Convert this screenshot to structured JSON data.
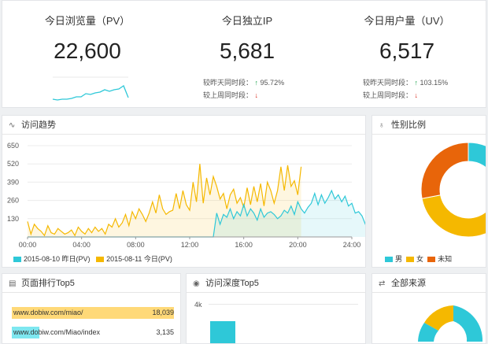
{
  "stats": [
    {
      "label": "今日浏览量（PV）",
      "value": "22,600"
    },
    {
      "label": "今日独立IP",
      "value": "5,681",
      "compare_day_label": "较昨天同时段：",
      "compare_day_value": "95.72%",
      "compare_week_label": "较上周同时段："
    },
    {
      "label": "今日用户量（UV）",
      "value": "6,517",
      "compare_day_label": "较昨天同时段：",
      "compare_day_value": "103.15%",
      "compare_week_label": "较上周同时段："
    }
  ],
  "trend": {
    "title": "访问趋势",
    "legend": [
      "2015-08-10 昨日(PV)",
      "2015-08-11 今日(PV)"
    ],
    "colors": [
      "#2ec8d8",
      "#f5b800"
    ],
    "chart_data": {
      "type": "line",
      "x_ticks": [
        "00:00",
        "04:00",
        "08:00",
        "12:00",
        "16:00",
        "20:00",
        "24:00"
      ],
      "y_ticks": [
        130,
        260,
        390,
        520,
        650
      ],
      "ylim": [
        0,
        650
      ],
      "series": [
        {
          "name": "2015-08-10 昨日(PV)",
          "values": [
            0,
            0,
            0,
            0,
            0,
            0,
            0,
            0,
            0,
            0,
            0,
            0,
            0,
            0,
            0,
            0,
            0,
            0,
            0,
            0,
            0,
            0,
            0,
            0,
            0,
            0,
            0,
            0,
            0,
            0,
            0,
            0,
            0,
            0,
            0,
            0,
            0,
            0,
            0,
            0,
            0,
            0,
            0,
            0,
            0,
            0,
            0,
            0,
            0,
            0,
            0,
            0,
            0,
            0,
            0,
            0,
            170,
            90,
            160,
            140,
            200,
            130,
            180,
            150,
            230,
            150,
            200,
            170,
            120,
            200,
            140,
            170,
            180,
            160,
            130,
            150,
            190,
            170,
            220,
            160,
            250,
            200,
            170,
            210,
            240,
            310,
            230,
            300,
            240,
            280,
            330,
            270,
            300,
            250,
            290,
            220,
            240,
            170,
            180,
            150,
            90,
            130,
            60,
            40
          ]
        },
        {
          "name": "2015-08-11 今日(PV)",
          "values": [
            110,
            20,
            90,
            60,
            40,
            10,
            80,
            30,
            20,
            60,
            40,
            20,
            30,
            50,
            10,
            70,
            40,
            20,
            60,
            30,
            70,
            40,
            60,
            20,
            90,
            70,
            130,
            70,
            100,
            160,
            80,
            180,
            130,
            200,
            160,
            110,
            170,
            250,
            170,
            300,
            200,
            160,
            180,
            190,
            310,
            200,
            330,
            230,
            190,
            390,
            250,
            520,
            240,
            420,
            300,
            430,
            360,
            270,
            310,
            200,
            300,
            340,
            240,
            280,
            210,
            350,
            230,
            360,
            250,
            380,
            220,
            390,
            330,
            240,
            330,
            500,
            330,
            510,
            360,
            400,
            300,
            500
          ]
        }
      ]
    }
  },
  "gender": {
    "title": "性别比例",
    "legend": [
      "男",
      "女",
      "未知"
    ],
    "colors": [
      "#2ec8d8",
      "#f5b800",
      "#e8650a"
    ],
    "chart_data": {
      "type": "pie",
      "labels": [
        "男",
        "女",
        "未知"
      ],
      "values": [
        35,
        37,
        28
      ]
    }
  },
  "ranking": {
    "title": "页面排行Top5",
    "items": [
      {
        "url": "www.dobiw.com/miao/",
        "count": "18,039",
        "ratio": 1.0,
        "color": "#ffd978"
      },
      {
        "url": "www.dobiw.com/Miao/index",
        "count": "3,135",
        "ratio": 0.17,
        "color": "#7ee7f0"
      }
    ]
  },
  "depth": {
    "title": "访问深度Top5",
    "ytick": "4k",
    "color": "#2ec8d8"
  },
  "sources": {
    "title": "全部来源",
    "colors": [
      "#2ec8d8",
      "#f5b800",
      "#e8650a"
    ]
  }
}
